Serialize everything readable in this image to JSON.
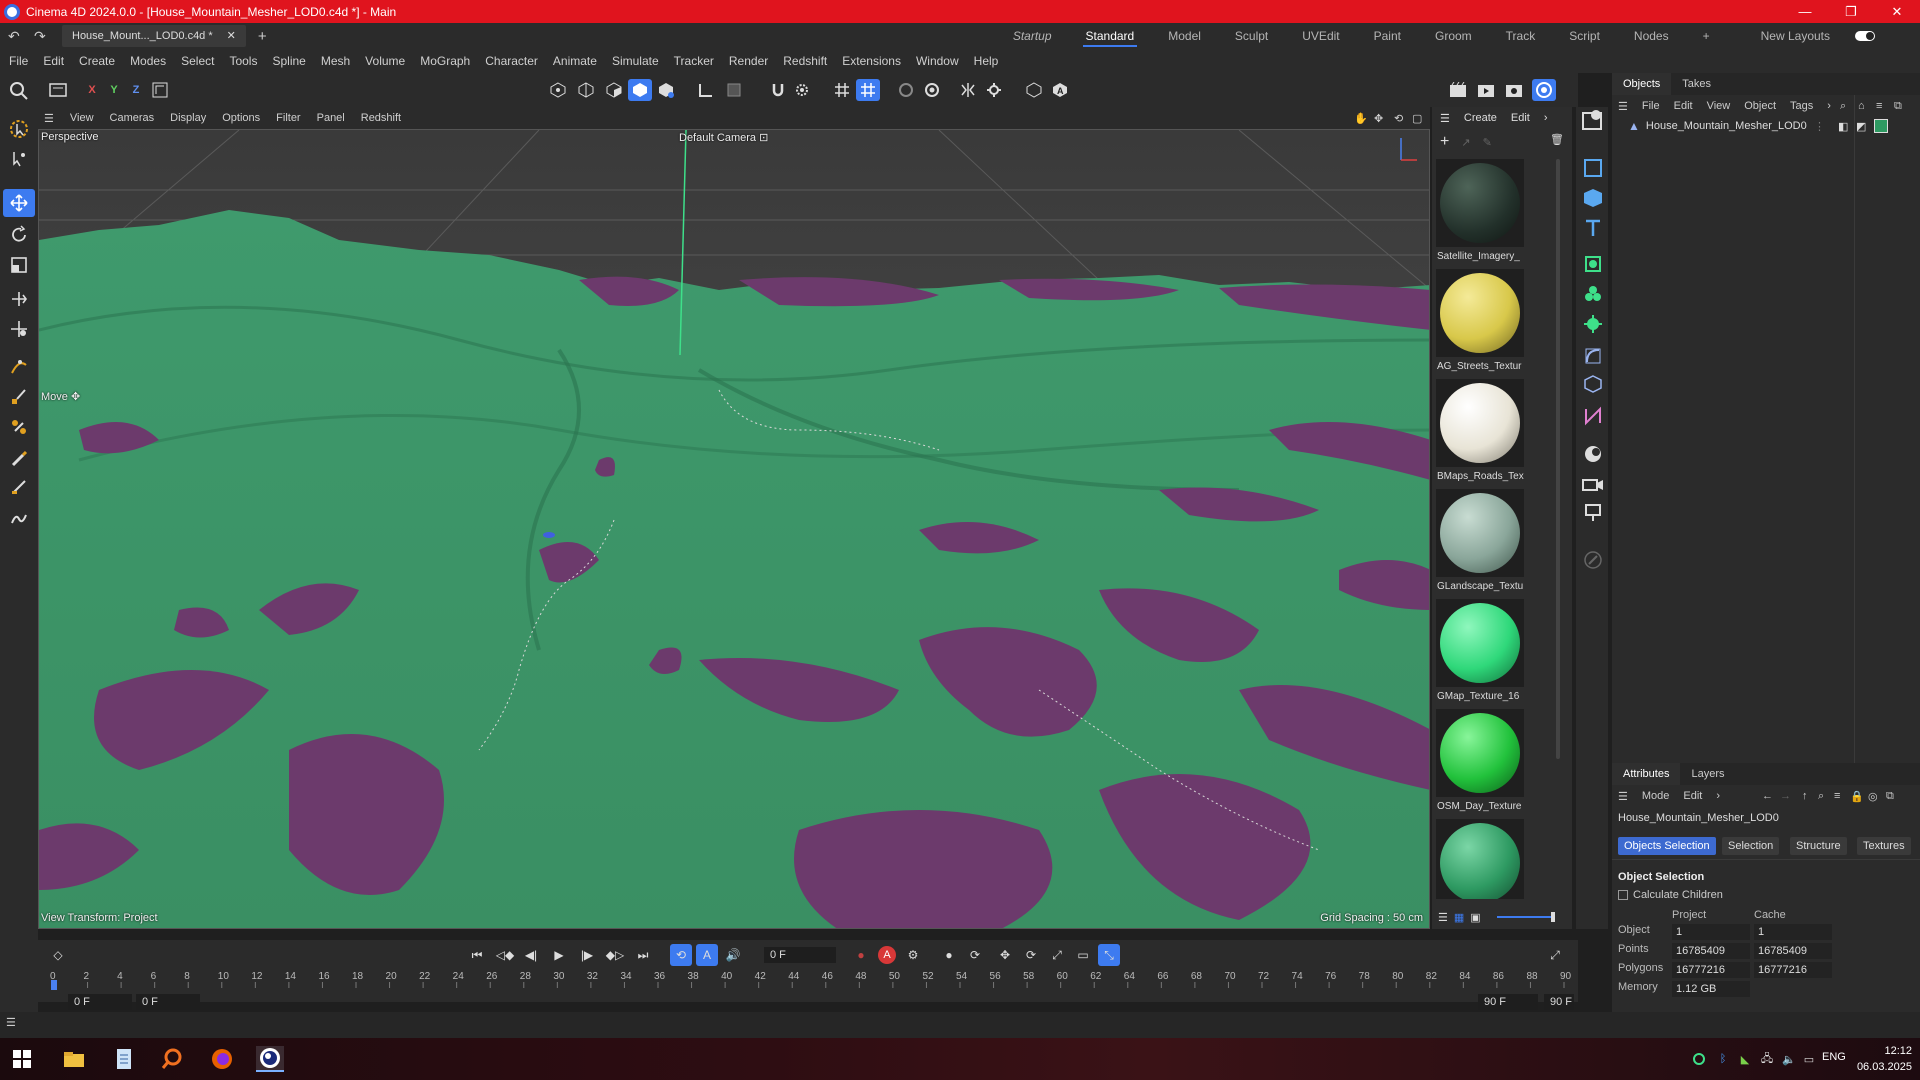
{
  "window": {
    "title": "Cinema 4D 2024.0.0 - [House_Mountain_Mesher_LOD0.c4d *] - Main",
    "minimize": "—",
    "restore": "❐",
    "close": "✕"
  },
  "tabs": {
    "document_tab": "House_Mount..._LOD0.c4d *",
    "document_close": "✕",
    "new_tab": "+",
    "layouts": [
      "Startup",
      "Standard",
      "Model",
      "Sculpt",
      "UVEdit",
      "Paint",
      "Groom",
      "Track",
      "Script",
      "Nodes"
    ],
    "active_layout": "Standard",
    "add_layout": "+",
    "new_layouts": "New Layouts"
  },
  "menu": [
    "File",
    "Edit",
    "Create",
    "Modes",
    "Select",
    "Tools",
    "Spline",
    "Mesh",
    "Volume",
    "MoGraph",
    "Character",
    "Animate",
    "Simulate",
    "Tracker",
    "Render",
    "Redshift",
    "Extensions",
    "Window",
    "Help"
  ],
  "axis_lock": {
    "x": "X",
    "y": "Y",
    "z": "Z"
  },
  "viewport": {
    "menu": [
      "View",
      "Cameras",
      "Display",
      "Options",
      "Filter",
      "Panel",
      "Redshift"
    ],
    "view_name": "Perspective",
    "camera": "Default Camera",
    "camera_icon": "⊡",
    "tool_label": "Move",
    "tool_icon": "✥",
    "transform_label": "View Transform: Project",
    "grid_spacing": "Grid Spacing : 50 cm"
  },
  "materials": {
    "menu": [
      "Create",
      "Edit"
    ],
    "more": "›",
    "items": [
      {
        "name": "Satellite_Imagery_",
        "color": "#2a3a30"
      },
      {
        "name": "AG_Streets_Textur",
        "color": "#d8c84a"
      },
      {
        "name": "BMaps_Roads_Tex",
        "color": "#e8e4d6"
      },
      {
        "name": "GLandscape_Textu",
        "color": "#8aa69a"
      },
      {
        "name": "GMap_Texture_16",
        "color": "#2fd87a"
      },
      {
        "name": "OSM_Day_Texture",
        "color": "#22c23c"
      },
      {
        "name": "",
        "color": "#2e9a62"
      }
    ]
  },
  "objects_panel": {
    "tabs": [
      "Objects",
      "Takes"
    ],
    "menu": [
      "File",
      "Edit",
      "View",
      "Object",
      "Tags"
    ],
    "more": "›",
    "object_name": "House_Mountain_Mesher_LOD0"
  },
  "attributes": {
    "tabs": [
      "Attributes",
      "Layers"
    ],
    "menu": [
      "Mode",
      "Edit"
    ],
    "more": "›",
    "object_name": "House_Mountain_Mesher_LOD0",
    "buttons": [
      "Objects Selection",
      "Selection",
      "Structure",
      "Textures"
    ],
    "section": "Object Selection",
    "checkbox": "Calculate Children",
    "col_project": "Project",
    "col_cache": "Cache",
    "rows": [
      {
        "label": "Object",
        "project": "1",
        "cache": "1"
      },
      {
        "label": "Points",
        "project": "16785409",
        "cache": "16785409"
      },
      {
        "label": "Polygons",
        "project": "16777216",
        "cache": "16777216"
      },
      {
        "label": "Memory",
        "project": "1.12 GB",
        "cache": ""
      }
    ]
  },
  "timeline": {
    "current_frame": "0 F",
    "start_frame": "0 F",
    "start_frame2": "0 F",
    "end_frame": "90 F",
    "end_frame2": "90 F",
    "ticks": [
      "0",
      "2",
      "4",
      "6",
      "8",
      "10",
      "12",
      "14",
      "16",
      "18",
      "20",
      "22",
      "24",
      "26",
      "28",
      "30",
      "32",
      "34",
      "36",
      "38",
      "40",
      "42",
      "44",
      "46",
      "48",
      "50",
      "52",
      "54",
      "56",
      "58",
      "60",
      "62",
      "64",
      "66",
      "68",
      "70",
      "72",
      "74",
      "76",
      "78",
      "80",
      "82",
      "84",
      "86",
      "88",
      "90"
    ]
  },
  "taskbar": {
    "language": "ENG",
    "time": "12:12",
    "date": "06.03.2025"
  },
  "colors": {
    "accent": "#3d7bf0",
    "title_red": "#e0141e",
    "terrain_green": "#3e9a6a",
    "terrain_purple": "#6c3a6c"
  }
}
